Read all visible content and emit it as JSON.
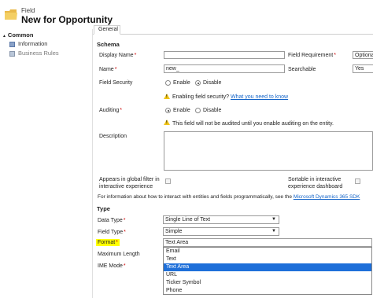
{
  "header": {
    "entity": "Field",
    "title": "New for Opportunity"
  },
  "sidebar": {
    "section": "Common",
    "items": [
      {
        "label": "Information"
      },
      {
        "label": "Business Rules"
      }
    ]
  },
  "tabs": [
    {
      "label": "General"
    }
  ],
  "schema": {
    "heading": "Schema",
    "display_name_label": "Display Name",
    "display_name_value": "",
    "field_requirement_label": "Field Requirement",
    "field_requirement_value": "Optiona",
    "name_label": "Name",
    "name_value": "new_",
    "searchable_label": "Searchable",
    "searchable_value": "Yes",
    "field_security_label": "Field Security",
    "enable_label": "Enable",
    "disable_label": "Disable",
    "security_note_prefix": "Enabling field security?",
    "security_note_link": "What you need to know",
    "auditing_label": "Auditing",
    "auditing_note": "This field will not be audited until you enable auditing on the entity.",
    "description_label": "Description",
    "description_value": "",
    "global_filter_label": "Appears in global filter in interactive experience",
    "sortable_label": "Sortable in interactive experience dashboard",
    "sdk_note_prefix": "For information about how to interact with entities and fields programmatically, see the",
    "sdk_note_link": "Microsoft Dynamics 365 SDK"
  },
  "type_section": {
    "heading": "Type",
    "data_type_label": "Data Type",
    "data_type_value": "Single Line of Text",
    "field_type_label": "Field Type",
    "field_type_value": "Simple",
    "format_label": "Format",
    "format_value": "Text Area",
    "max_length_label": "Maximum Length",
    "ime_mode_label": "IME Mode",
    "format_options": [
      "Email",
      "Text",
      "Text Area",
      "URL",
      "Ticker Symbol",
      "Phone"
    ],
    "format_selected_index": 2
  },
  "colors": {
    "highlight": "#ffff00",
    "selection": "#1e6fd9",
    "link": "#1464c8",
    "required": "#cc0000"
  }
}
